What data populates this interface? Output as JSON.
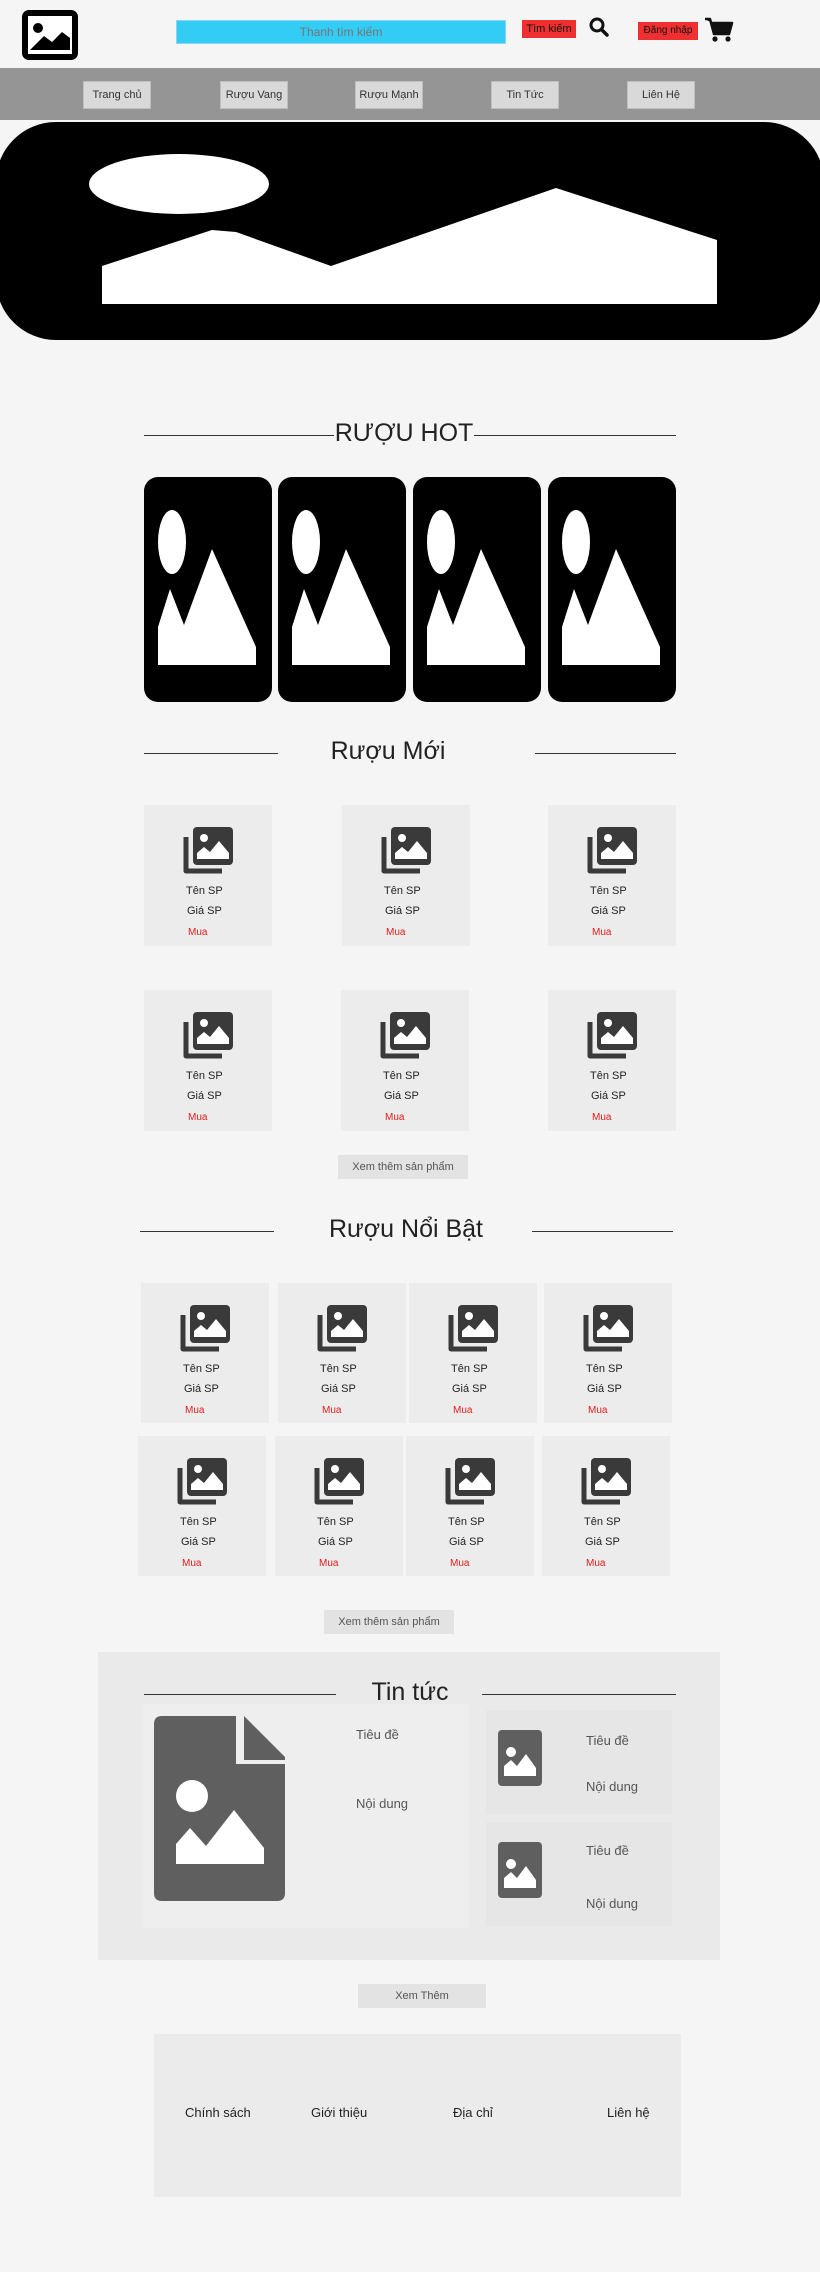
{
  "header": {
    "search_placeholder": "Thanh tìm kiếm",
    "search_button": "Tìm kiếm",
    "login_button": "Đăng nhập"
  },
  "nav": [
    "Trang chủ",
    "Rượu Vang",
    "Rượu Mạnh",
    "Tin Tức",
    "Liên Hệ"
  ],
  "sections": {
    "hot_title": "RƯỢU HOT",
    "new_title": "Rượu Mới",
    "featured_title": "Rượu Nổi Bật",
    "news_title": "Tin tức"
  },
  "product": {
    "name": "Tên SP",
    "price": "Giá SP",
    "buy": "Mua"
  },
  "more_products": "Xem thêm sản phẩm",
  "news": {
    "title": "Tiêu đề",
    "content": "Nội dung",
    "more": "Xem Thêm"
  },
  "footer": [
    "Chính sách",
    "Giới thiệu",
    "Địa chỉ",
    "Liên hệ"
  ],
  "colors": {
    "search_bar": "#33ccf5",
    "action_buttons": "#f03030",
    "buy_text": "#e41b1b",
    "nav_bar": "#959595"
  }
}
